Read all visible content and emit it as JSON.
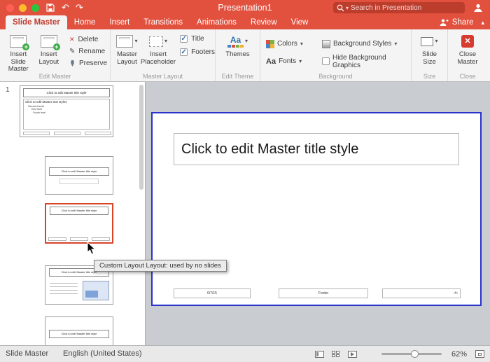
{
  "colors": {
    "titlebar": "#e2503e",
    "tab_active_text": "#c13b2e",
    "selection_border": "#2a33cb",
    "selected_thumbnail_border": "#d8432a"
  },
  "titlebar": {
    "title": "Presentation1",
    "search_placeholder": "Search in Presentation"
  },
  "tabs": {
    "items": [
      {
        "label": "Slide Master"
      },
      {
        "label": "Home"
      },
      {
        "label": "Insert"
      },
      {
        "label": "Transitions"
      },
      {
        "label": "Animations"
      },
      {
        "label": "Review"
      },
      {
        "label": "View"
      }
    ],
    "share": "Share"
  },
  "ribbon": {
    "insert_slide_master": "Insert Slide Master",
    "insert_layout": "Insert Layout",
    "delete": "Delete",
    "rename": "Rename",
    "preserve": "Preserve",
    "group_edit_master": "Edit Master",
    "master_layout": "Master Layout",
    "insert_placeholder": "Insert Placeholder",
    "title_check": "Title",
    "footers_check": "Footers",
    "group_master_layout": "Master Layout",
    "themes": "Themes",
    "group_edit_theme": "Edit Theme",
    "colors": "Colors",
    "fonts": "Fonts",
    "background_styles": "Background Styles",
    "hide_background_graphics": "Hide Background Graphics",
    "group_background": "Background",
    "slide_size": "Slide Size",
    "group_size": "Size",
    "close_master": "Close Master",
    "group_close": "Close"
  },
  "sidebar": {
    "slide_number": "1",
    "master": {
      "title": "Click to edit Master title style",
      "body_lines": [
        "Click to edit Master text styles",
        "Second level",
        "Third level",
        "Fourth level"
      ]
    },
    "layouts": [
      {
        "title": "Click to edit Master title style"
      },
      {
        "title": "Click to edit Master title style"
      },
      {
        "title": "Click to edit Master title style"
      },
      {
        "title": "Click to edit Master title style"
      }
    ],
    "tooltip": "Custom Layout Layout: used by no slides"
  },
  "slide": {
    "title": "Click to edit Master title style",
    "date_placeholder": "6/7/15",
    "footer_placeholder": "Footer",
    "number_placeholder": "‹#›"
  },
  "statusbar": {
    "view_label": "Slide Master",
    "language": "English (United States)",
    "zoom": "62%"
  },
  "icons": {
    "undo": "↶",
    "redo": "↷",
    "caret_down": "▾",
    "caret_up": "▴",
    "delete_x": "✕",
    "rename": "✎",
    "check": "✓",
    "aa": "Aa",
    "plus": "+",
    "close_x": "✕"
  }
}
